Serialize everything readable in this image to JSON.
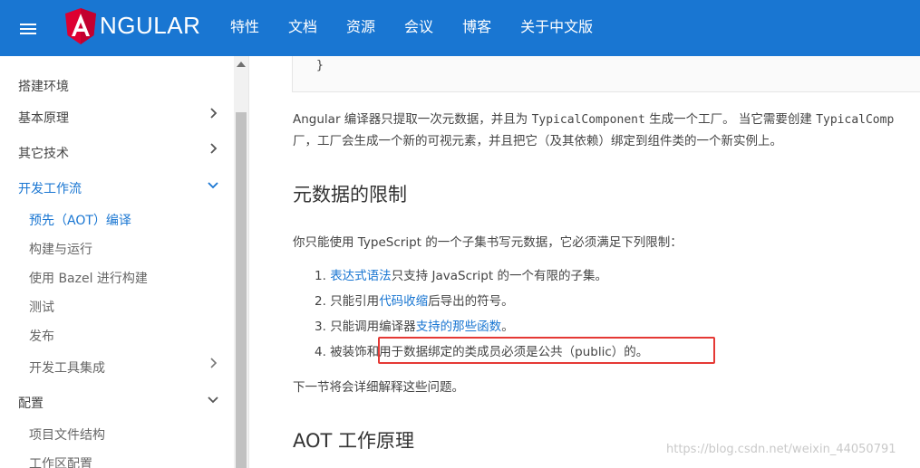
{
  "header": {
    "brand": "NGULAR",
    "nav": [
      "特性",
      "文档",
      "资源",
      "会议",
      "博客",
      "关于中文版"
    ]
  },
  "sidebar": {
    "items": [
      {
        "label": "搭建环境"
      },
      {
        "label": "基本原理"
      },
      {
        "label": "其它技术"
      },
      {
        "label": "开发工作流"
      },
      {
        "label": "预先（AOT）编译"
      },
      {
        "label": "构建与运行"
      },
      {
        "label": "使用 Bazel 进行构建"
      },
      {
        "label": "测试"
      },
      {
        "label": "发布"
      },
      {
        "label": "开发工具集成"
      },
      {
        "label": "配置"
      },
      {
        "label": "项目文件结构"
      },
      {
        "label": "工作区配置"
      }
    ]
  },
  "content": {
    "code_tail": "}",
    "para1_a": "Angular 编译器只提取一次元数据，并且为 ",
    "para1_code1": "TypicalComponent",
    "para1_b": " 生成一个工厂。 当它需要创建 ",
    "para1_code2": "TypicalComp",
    "para1_line2": "厂，工厂会生成一个新的可视元素，并且把它（及其依赖）绑定到组件类的一个新实例上。",
    "h2_limits": "元数据的限制",
    "para2": "你只能使用 TypeScript 的一个子集书写元数据，它必须满足下列限制：",
    "li1_num": "1.",
    "li1_link": "表达式语法",
    "li1_text": "只支持 JavaScript 的一个有限的子集。",
    "li2_num": "2.",
    "li2_a": "只能引用",
    "li2_link": "代码收缩",
    "li2_b": "后导出的符号。",
    "li3_num": "3.",
    "li3_a": "只能调用编译器",
    "li3_link": "支持的那些函数",
    "li3_b": "。",
    "li4": "4. 被装饰和用于数据绑定的类成员必须是公共（public）的。",
    "para3": "下一节将会详细解释这些问题。",
    "h2_aot": "AOT 工作原理",
    "watermark": "https://blog.csdn.net/weixin_44050791"
  },
  "colors": {
    "topbar": "#1976d2",
    "link": "#1976d2",
    "highlight_box": "#e53935"
  }
}
